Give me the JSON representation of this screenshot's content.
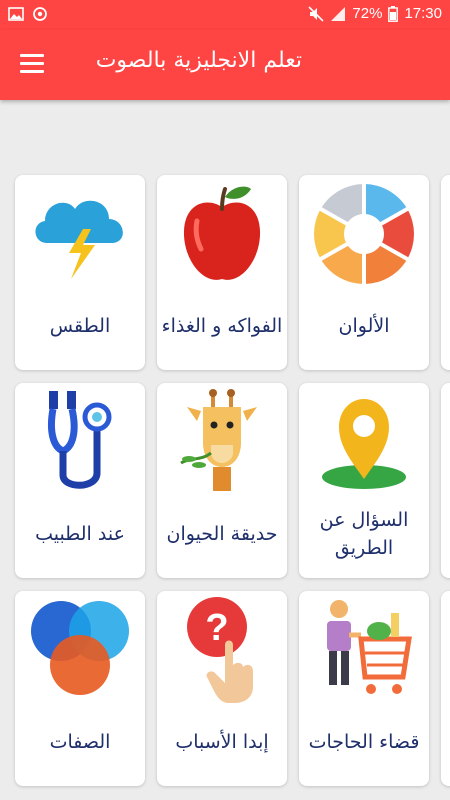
{
  "status_bar": {
    "battery": "72%",
    "time": "17:30"
  },
  "app_bar": {
    "title": "تعلم الانجليزية بالصوت"
  },
  "categories": [
    {
      "label": "الألوان",
      "icon": "color-wheel-icon"
    },
    {
      "label": "الفواكه و الغذاء",
      "icon": "apple-icon"
    },
    {
      "label": "الطقس",
      "icon": "cloud-lightning-icon"
    },
    {
      "label": "السؤال عن الطريق",
      "icon": "map-pin-icon"
    },
    {
      "label": "حديقة الحيوان",
      "icon": "giraffe-icon"
    },
    {
      "label": "عند الطبيب",
      "icon": "stethoscope-icon"
    },
    {
      "label": "قضاء الحاجات",
      "icon": "shopping-cart-icon"
    },
    {
      "label": "إبدا الأسباب",
      "icon": "question-hand-icon"
    },
    {
      "label": "الصفات",
      "icon": "venn-circles-icon"
    }
  ],
  "colors": {
    "primary": "#ff4444",
    "label_text": "#1e2f6b",
    "background": "#ececec"
  }
}
